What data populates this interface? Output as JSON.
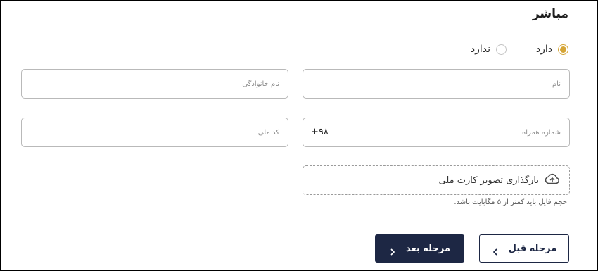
{
  "section": {
    "title": "مباشر"
  },
  "radio": {
    "selected": "yes",
    "options": [
      {
        "id": "yes",
        "label": "دارد"
      },
      {
        "id": "no",
        "label": "ندارد"
      }
    ]
  },
  "fields": {
    "first_name_placeholder": "نام",
    "last_name_placeholder": "نام خانوادگی",
    "phone_placeholder": "شماره همراه",
    "phone_prefix": "+۹۸",
    "national_code_placeholder": "کد ملی"
  },
  "upload": {
    "label": "بارگذاری تصویر کارت ملی",
    "hint": "حجم فایل باید کمتر از ۵ مگابایت باشد.",
    "icon": "cloud-upload-icon"
  },
  "buttons": {
    "prev_label": "مرحله قبل",
    "next_label": "مرحله بعد"
  },
  "colors": {
    "accent": "#d5a536",
    "primary": "#1d2744",
    "border": "#b9b9b9"
  }
}
